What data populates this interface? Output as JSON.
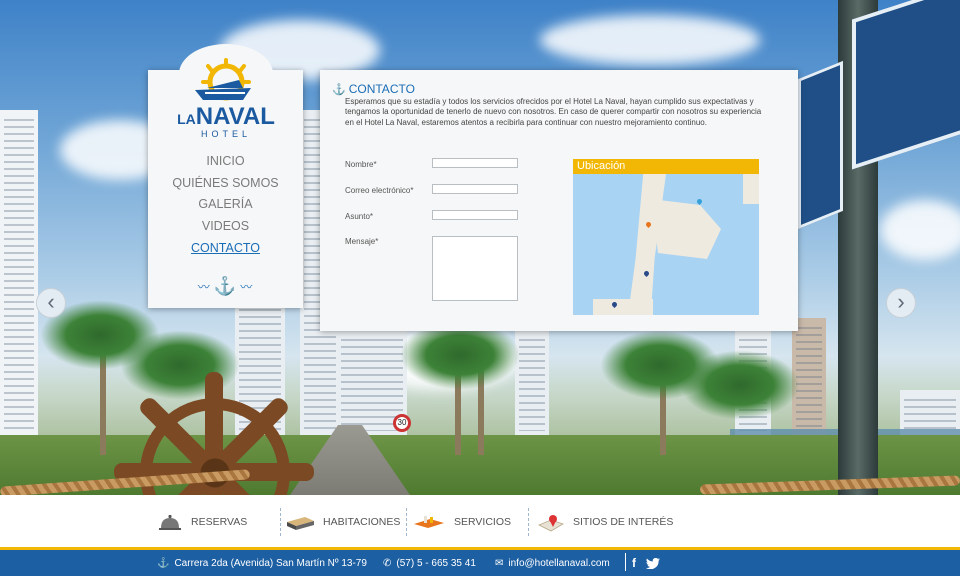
{
  "nav": {
    "items": [
      {
        "label": "INICIO"
      },
      {
        "label": "QUIÉNES SOMOS"
      },
      {
        "label": "GALERÍA"
      },
      {
        "label": "VIDEOS"
      },
      {
        "label": "CONTACTO"
      }
    ],
    "active": "CONTACTO"
  },
  "logo": {
    "la": "LA",
    "naval": "NAVAL",
    "hotel": "HOTEL"
  },
  "slider": {
    "prev_icon": "chevron-left-icon",
    "next_icon": "chevron-right-icon"
  },
  "contact": {
    "title": "CONTACTO",
    "intro": "Esperamos que su estadía y todos los servicios ofrecidos por el Hotel La Naval, hayan cumplido sus expectativas y tengamos la oportunidad de tenerlo de nuevo con nosotros. En caso de querer compartir con nosotros su experiencia en el Hotel La Naval, estaremos atentos a recibirla para continuar con nuestro mejoramiento continuo.",
    "fields": {
      "nombre": {
        "label": "Nombre*",
        "value": ""
      },
      "correo": {
        "label": "Correo electrónico*",
        "value": ""
      },
      "asunto": {
        "label": "Asunto*",
        "value": ""
      },
      "mensaje": {
        "label": "Mensaje*",
        "value": ""
      }
    },
    "map_title": "Ubicación"
  },
  "bottom_nav": [
    {
      "label": "RESERVAS",
      "icon": "bell-icon"
    },
    {
      "label": "HABITACIONES",
      "icon": "bed-icon"
    },
    {
      "label": "SERVICIOS",
      "icon": "tray-icon"
    },
    {
      "label": "SITIOS DE INTERÉS",
      "icon": "map-pin-icon"
    }
  ],
  "footer": {
    "address": "Carrera 2da  (Avenida) San Martín Nº 13-79",
    "phone": "(57) 5 - 665 35 41",
    "email": "info@hotellanaval.com",
    "social": [
      "f",
      "twitter"
    ]
  },
  "colors": {
    "brand": "#1b6db6",
    "accent": "#f2b705",
    "footer": "#1d5fa3"
  }
}
